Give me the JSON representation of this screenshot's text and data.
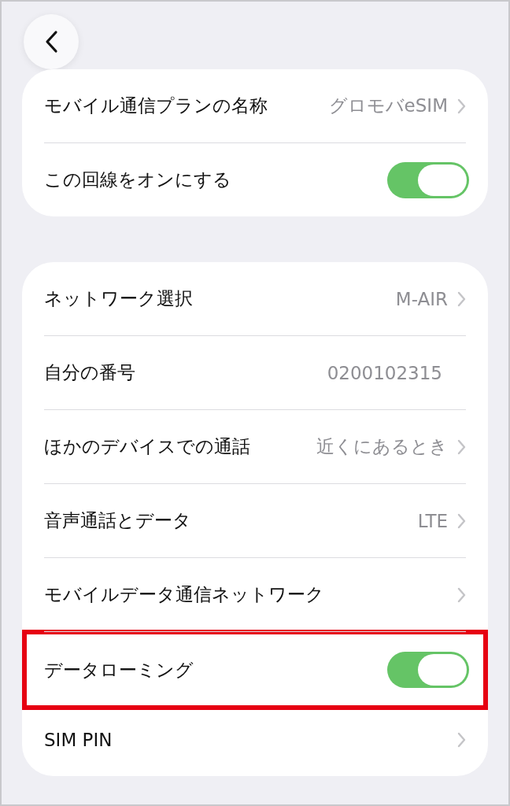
{
  "groups": [
    {
      "rows": [
        {
          "kind": "link",
          "label": "モバイル通信プランの名称",
          "value": "グロモバeSIM",
          "highlighted": false
        },
        {
          "kind": "toggle",
          "label": "この回線をオンにする",
          "on": true,
          "highlighted": false
        }
      ]
    },
    {
      "rows": [
        {
          "kind": "link",
          "label": "ネットワーク選択",
          "value": "M-AIR",
          "highlighted": false
        },
        {
          "kind": "value",
          "label": "自分の番号",
          "value": "0200102315",
          "highlighted": false
        },
        {
          "kind": "link",
          "label": "ほかのデバイスでの通話",
          "value": "近くにあるとき",
          "highlighted": false
        },
        {
          "kind": "link",
          "label": "音声通話とデータ",
          "value": "LTE",
          "highlighted": false
        },
        {
          "kind": "link",
          "label": "モバイルデータ通信ネットワーク",
          "highlighted": false
        },
        {
          "kind": "toggle",
          "label": "データローミング",
          "on": true,
          "highlighted": true
        },
        {
          "kind": "link",
          "label": "SIM PIN",
          "highlighted": false
        }
      ]
    }
  ]
}
